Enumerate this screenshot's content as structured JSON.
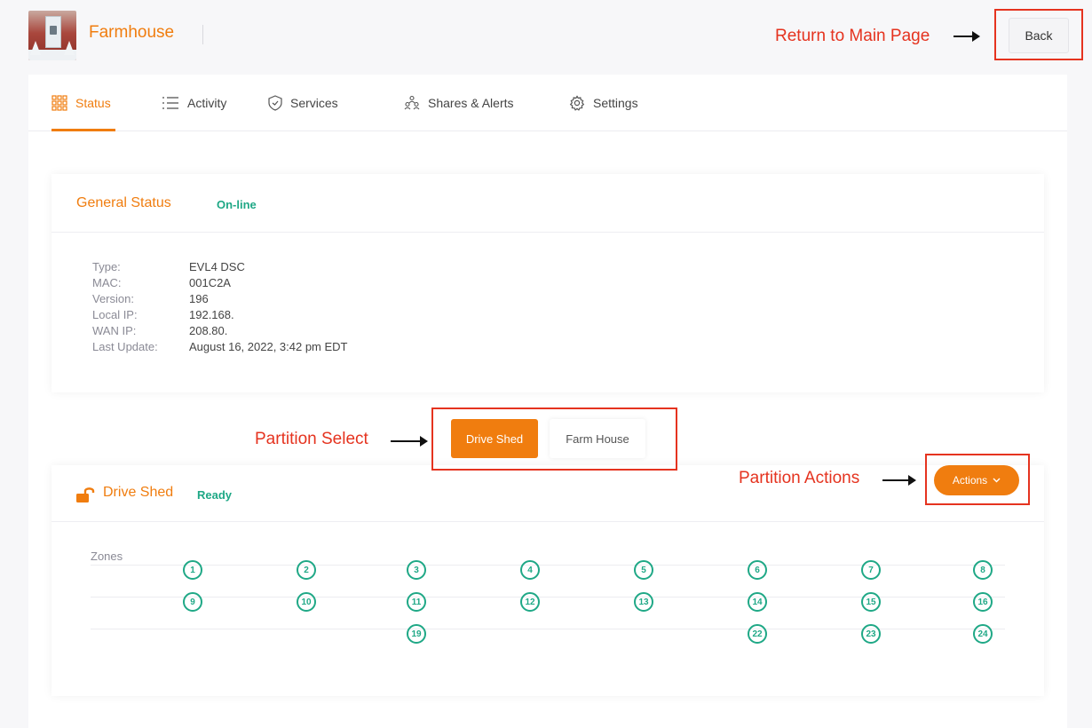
{
  "header": {
    "site_name": "Farmhouse",
    "back_label": "Back"
  },
  "annotations": {
    "return_main": "Return to Main Page",
    "partition_select": "Partition Select",
    "partition_actions": "Partition Actions"
  },
  "tabs": [
    {
      "label": "Status",
      "icon": "grid-icon",
      "active": true
    },
    {
      "label": "Activity",
      "icon": "list-icon"
    },
    {
      "label": "Services",
      "icon": "shield-icon"
    },
    {
      "label": "Shares & Alerts",
      "icon": "people-icon"
    },
    {
      "label": "Settings",
      "icon": "gear-icon"
    }
  ],
  "general_status": {
    "title": "General Status",
    "status": "On-line",
    "rows": [
      {
        "label": "Type:",
        "value": "EVL4 DSC"
      },
      {
        "label": "MAC:",
        "value": "001C2A"
      },
      {
        "label": "Version:",
        "value": "196"
      },
      {
        "label": "Local IP:",
        "value": "192.168."
      },
      {
        "label": "WAN IP:",
        "value": "208.80."
      },
      {
        "label": "Last Update:",
        "value": "August 16, 2022, 3:42 pm EDT"
      }
    ]
  },
  "partitions": {
    "options": [
      "Drive Shed",
      "Farm House"
    ],
    "selected": "Drive Shed"
  },
  "partition": {
    "title": "Drive Shed",
    "status": "Ready",
    "actions_label": "Actions",
    "zones_label": "Zones",
    "zone_rows": [
      [
        "1",
        "2",
        "3",
        "4",
        "5",
        "6",
        "7",
        "8"
      ],
      [
        "9",
        "10",
        "11",
        "12",
        "13",
        "14",
        "15",
        "16"
      ],
      [
        "",
        "",
        "19",
        "",
        "",
        "22",
        "23",
        "24"
      ]
    ]
  },
  "colors": {
    "accent": "#f07d0f",
    "success": "#1fa886",
    "annotation": "#e5331f"
  }
}
